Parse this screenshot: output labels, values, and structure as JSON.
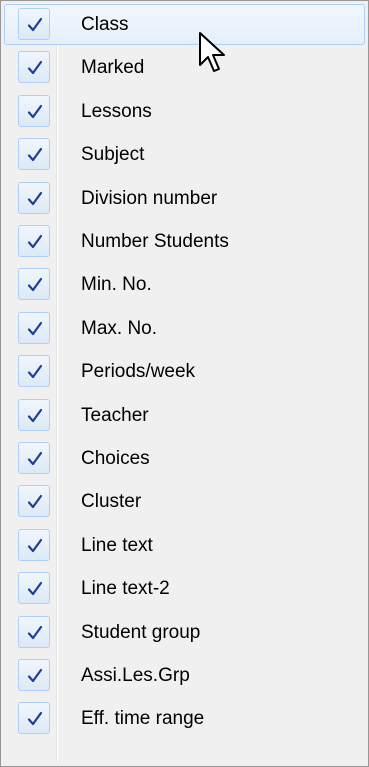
{
  "menu": {
    "check_color": "#1f3f95",
    "hover_index": 0,
    "items": [
      {
        "label": "Class",
        "checked": true
      },
      {
        "label": "Marked",
        "checked": true
      },
      {
        "label": "Lessons",
        "checked": true
      },
      {
        "label": "Subject",
        "checked": true
      },
      {
        "label": "Division number",
        "checked": true
      },
      {
        "label": "Number Students",
        "checked": true
      },
      {
        "label": "Min. No.",
        "checked": true
      },
      {
        "label": "Max. No.",
        "checked": true
      },
      {
        "label": "Periods/week",
        "checked": true
      },
      {
        "label": "Teacher",
        "checked": true
      },
      {
        "label": "Choices",
        "checked": true
      },
      {
        "label": "Cluster",
        "checked": true
      },
      {
        "label": "Line text",
        "checked": true
      },
      {
        "label": "Line text-2",
        "checked": true
      },
      {
        "label": "Student group",
        "checked": true
      },
      {
        "label": "Assi.Les.Grp",
        "checked": true
      },
      {
        "label": "Eff. time range",
        "checked": true
      }
    ]
  }
}
